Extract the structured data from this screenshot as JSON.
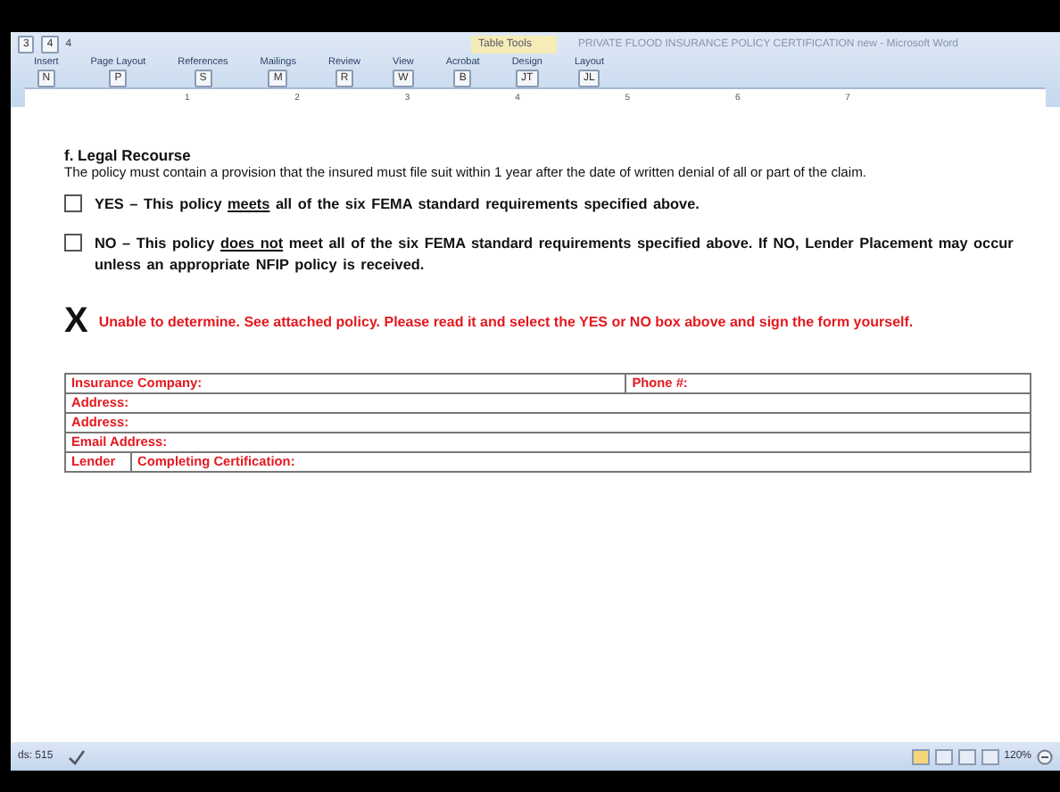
{
  "quick_access": {
    "keytips": [
      "3",
      "4"
    ],
    "extra": "4"
  },
  "contextual_tab": "Table Tools",
  "window_title": "PRIVATE FLOOD INSURANCE POLICY CERTIFICATION new - Microsoft Word",
  "ribbon_tabs": [
    {
      "label": "Insert",
      "keytip": "N"
    },
    {
      "label": "Page Layout",
      "keytip": "P"
    },
    {
      "label": "References",
      "keytip": "S"
    },
    {
      "label": "Mailings",
      "keytip": "M"
    },
    {
      "label": "Review",
      "keytip": "R"
    },
    {
      "label": "View",
      "keytip": "W"
    },
    {
      "label": "Acrobat",
      "keytip": "B"
    },
    {
      "label": "Design",
      "keytip": "JT"
    },
    {
      "label": "Layout",
      "keytip": "JL"
    }
  ],
  "ruler_numbers": [
    "1",
    "2",
    "3",
    "4",
    "5",
    "6",
    "7"
  ],
  "document": {
    "heading": "f. Legal Recourse",
    "paragraph": "The policy must contain a provision that the insured must file suit within 1 year after the date of written denial of all or part of the claim.",
    "options": [
      {
        "checked": false,
        "lead": "YES – This policy ",
        "underlined": "meets",
        "rest": " all of the six FEMA standard requirements specified above."
      },
      {
        "checked": false,
        "lead": "NO – This policy ",
        "underlined": "does not",
        "rest": " meet all of the six FEMA standard requirements specified above. If NO, Lender Placement may occur unless an appropriate NFIP policy is received."
      }
    ],
    "mark": "X",
    "note": "Unable to determine.  See attached policy.  Please read it and select the YES or NO box above and sign the form yourself.",
    "form_rows": [
      {
        "cells": [
          "Insurance Company:",
          "Phone #:"
        ]
      },
      {
        "cells": [
          "Address:"
        ]
      },
      {
        "cells": [
          "Address:"
        ]
      },
      {
        "cells": [
          "Email Address:"
        ]
      },
      {
        "cells": [
          "Lender",
          "Completing Certification:"
        ]
      }
    ]
  },
  "status_bar": {
    "words": "ds: 515",
    "zoom": "120%"
  }
}
